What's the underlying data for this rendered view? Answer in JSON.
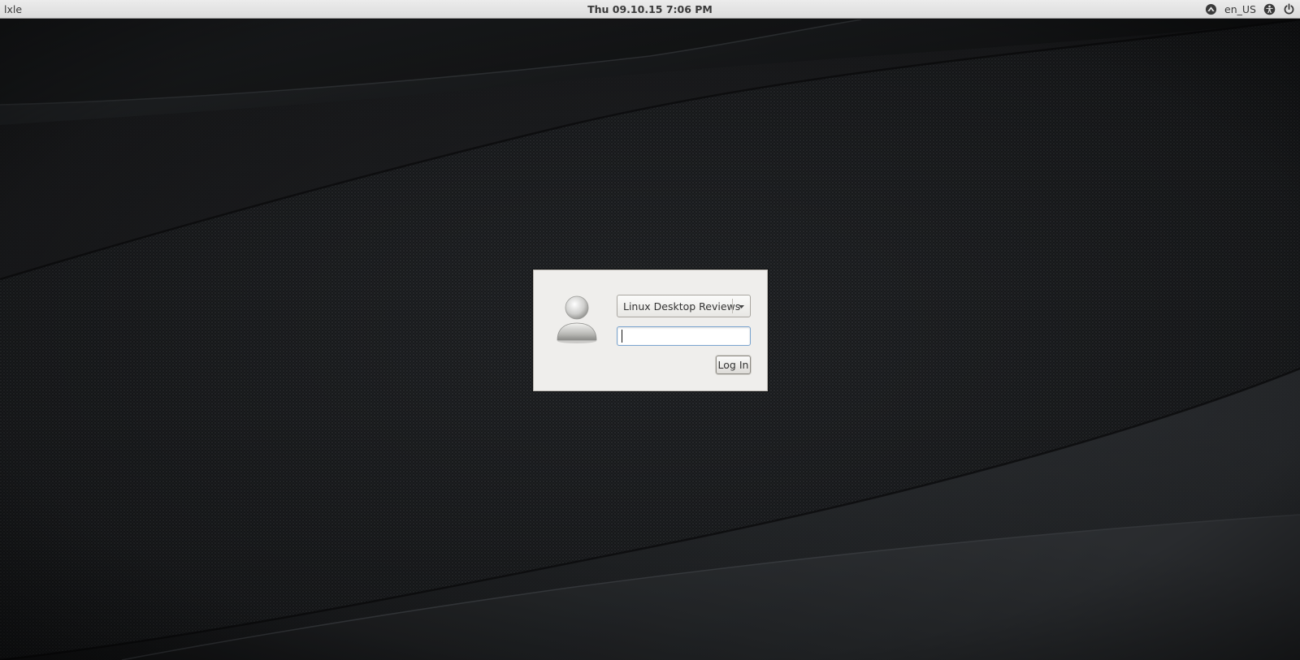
{
  "panel": {
    "hostname": "lxle",
    "datetime": "Thu 09.10.15  7:06 PM",
    "language": "en_US"
  },
  "icons": {
    "network": "network-icon",
    "accessibility": "accessibility-icon",
    "power": "power-icon",
    "avatar": "user-avatar-icon",
    "dropdown": "chevron-down-icon"
  },
  "login": {
    "selected_user": "Linux Desktop Reviews",
    "password_value": "",
    "login_label": "Log In"
  },
  "colors": {
    "panel_bg": "#e4e4e4",
    "dialog_bg": "#efeeec",
    "focus_border": "#7aa4cf"
  }
}
